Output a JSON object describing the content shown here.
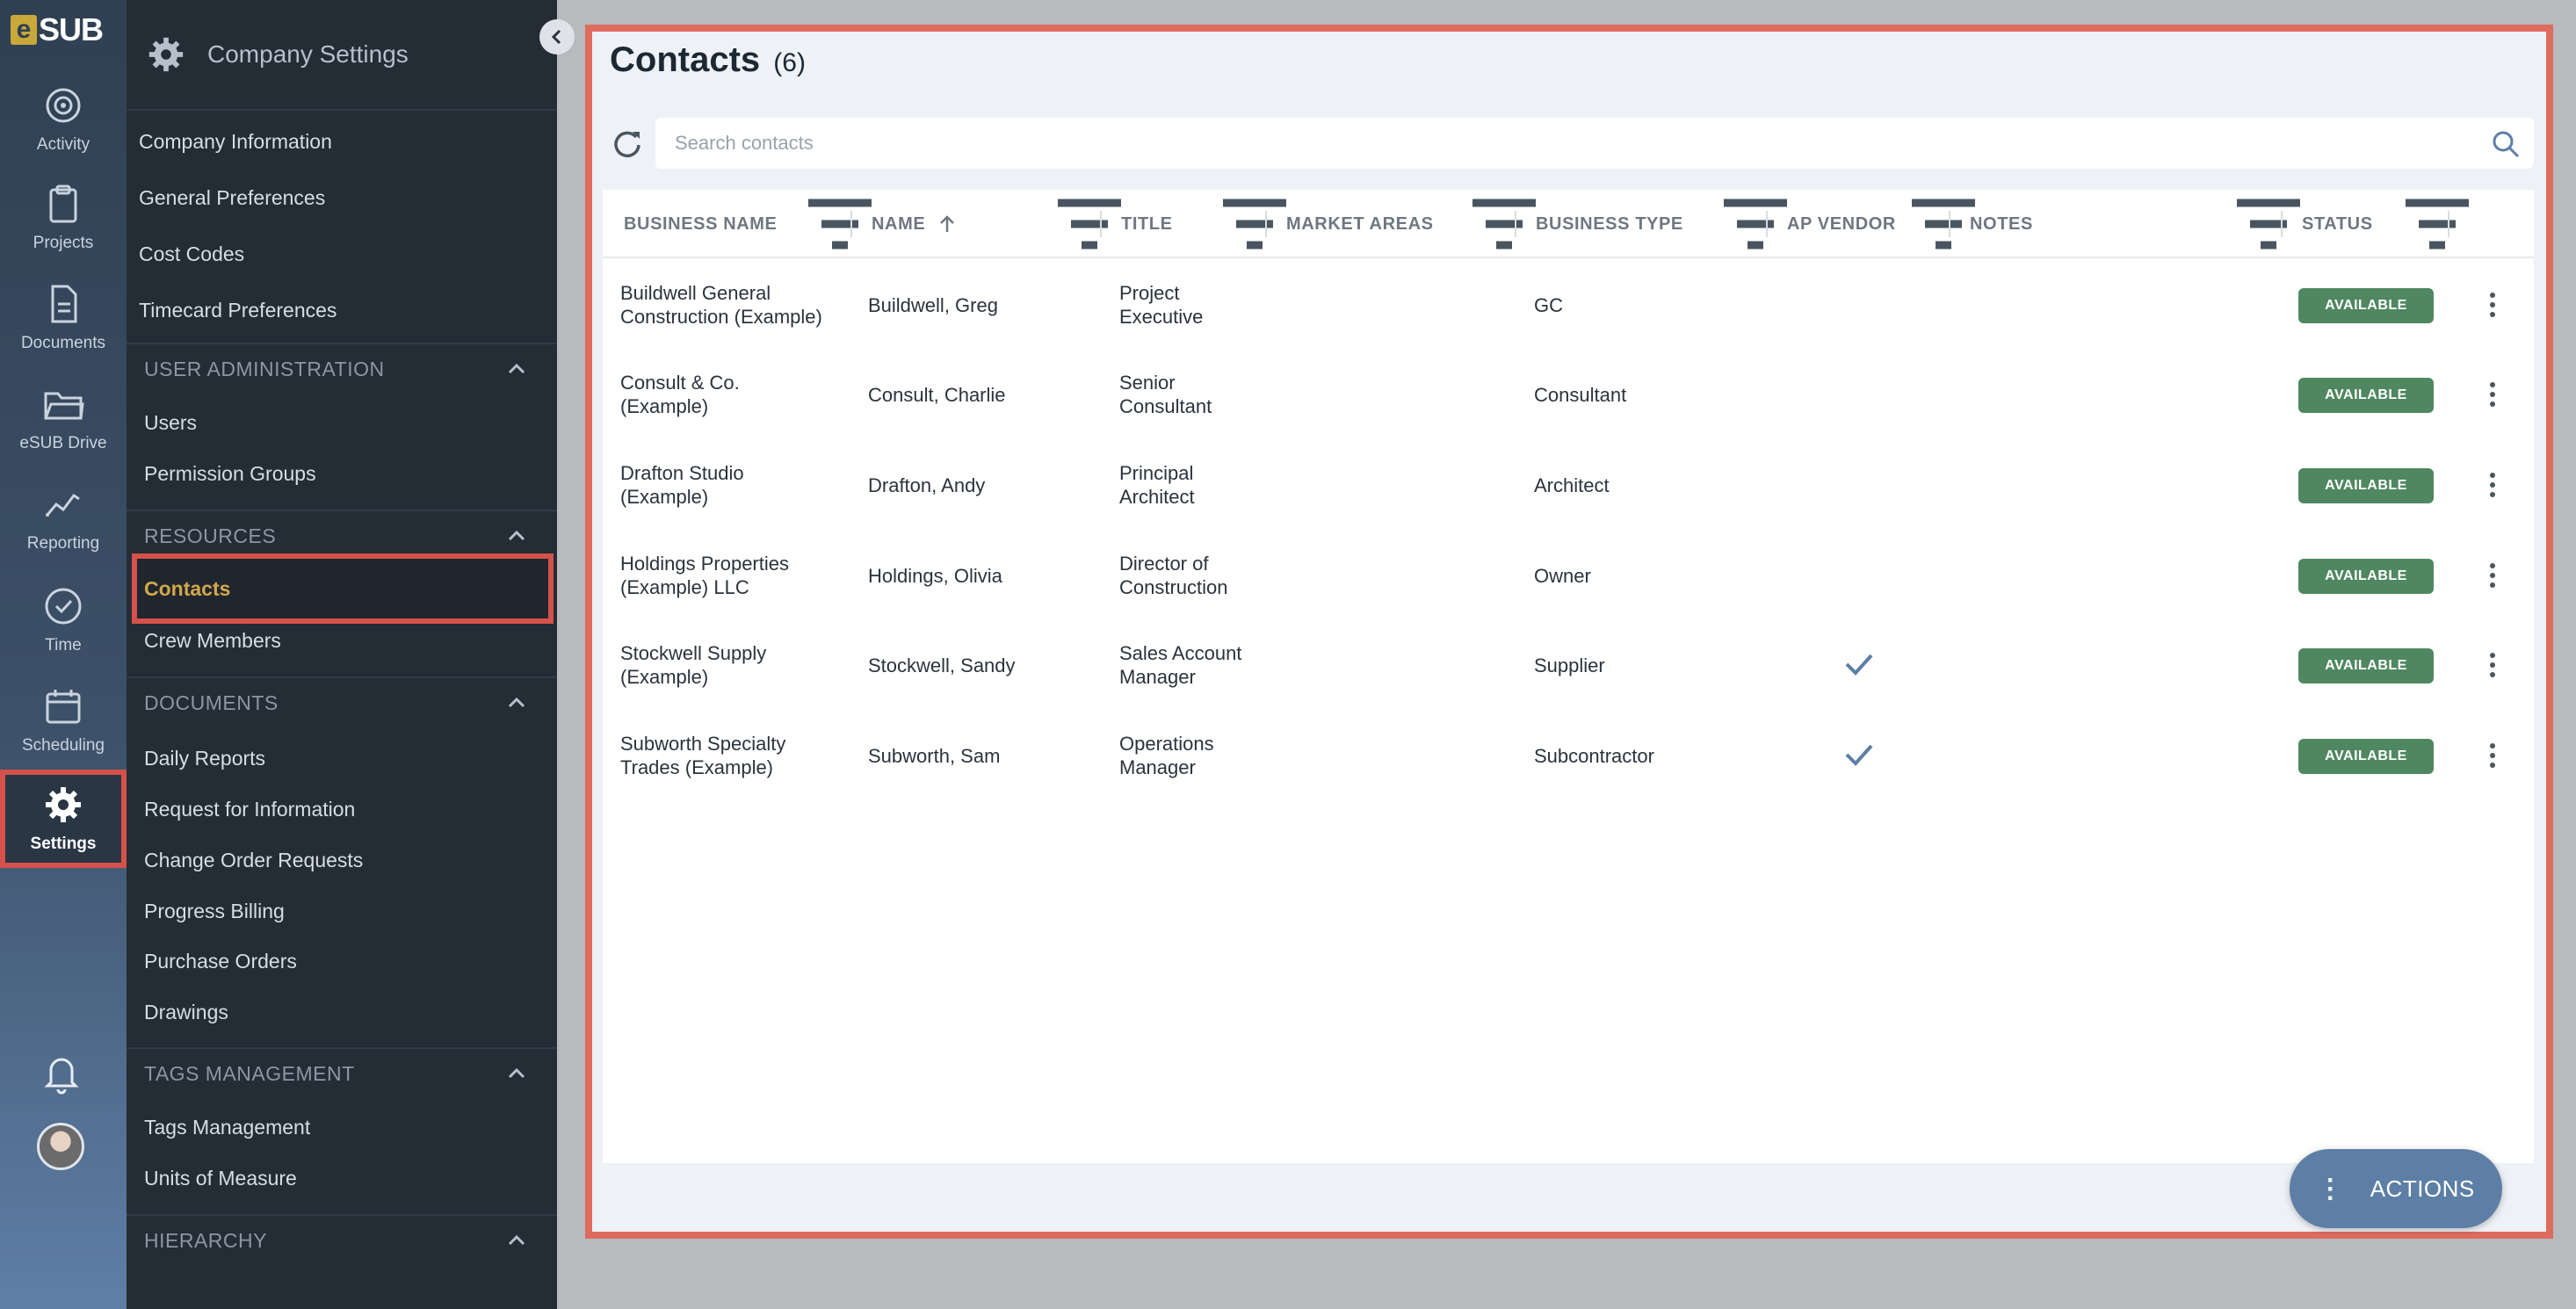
{
  "brand": {
    "logo_e": "e",
    "logo_rest": "SUB"
  },
  "rail": {
    "items": [
      {
        "label": "Activity",
        "icon": "activity-icon"
      },
      {
        "label": "Projects",
        "icon": "clipboard-icon"
      },
      {
        "label": "Documents",
        "icon": "document-icon"
      },
      {
        "label": "eSUB Drive",
        "icon": "folder-icon"
      },
      {
        "label": "Reporting",
        "icon": "chart-line-icon"
      },
      {
        "label": "Time",
        "icon": "clock-icon"
      },
      {
        "label": "Scheduling",
        "icon": "calendar-icon"
      },
      {
        "label": "Settings",
        "icon": "gear-icon"
      }
    ]
  },
  "panel": {
    "title": "Company Settings",
    "top_links": [
      "Company Information",
      "General Preferences",
      "Cost Codes",
      "Timecard Preferences"
    ],
    "sections": [
      {
        "title": "USER ADMINISTRATION",
        "links": [
          "Users",
          "Permission Groups"
        ]
      },
      {
        "title": "RESOURCES",
        "links": [
          "Contacts",
          "Crew Members"
        ]
      },
      {
        "title": "DOCUMENTS",
        "links": [
          "Daily Reports",
          "Request for Information",
          "Change Order Requests",
          "Progress Billing",
          "Purchase Orders",
          "Drawings"
        ]
      },
      {
        "title": "TAGS MANAGEMENT",
        "links": [
          "Tags Management",
          "Units of Measure"
        ]
      },
      {
        "title": "HIERARCHY",
        "links": []
      }
    ]
  },
  "main": {
    "title": "Contacts",
    "count": "(6)",
    "search_placeholder": "Search contacts",
    "columns": [
      "BUSINESS NAME",
      "NAME",
      "TITLE",
      "MARKET AREAS",
      "BUSINESS TYPE",
      "AP VENDOR",
      "NOTES",
      "STATUS"
    ],
    "rows": [
      {
        "business": [
          "Buildwell General",
          "Construction (Example)"
        ],
        "name": "Buildwell, Greg",
        "title": [
          "Project",
          "Executive"
        ],
        "type": "GC",
        "ap_vendor": false,
        "status": "AVAILABLE"
      },
      {
        "business": [
          "Consult & Co.",
          "(Example)"
        ],
        "name": "Consult, Charlie",
        "title": [
          "Senior",
          "Consultant"
        ],
        "type": "Consultant",
        "ap_vendor": false,
        "status": "AVAILABLE"
      },
      {
        "business": [
          "Drafton Studio",
          "(Example)"
        ],
        "name": "Drafton, Andy",
        "title": [
          "Principal",
          "Architect"
        ],
        "type": "Architect",
        "ap_vendor": false,
        "status": "AVAILABLE"
      },
      {
        "business": [
          "Holdings Properties",
          "(Example) LLC"
        ],
        "name": "Holdings, Olivia",
        "title": [
          "Director of",
          "Construction"
        ],
        "type": "Owner",
        "ap_vendor": false,
        "status": "AVAILABLE"
      },
      {
        "business": [
          "Stockwell Supply",
          "(Example)"
        ],
        "name": "Stockwell, Sandy",
        "title": [
          "Sales Account",
          "Manager"
        ],
        "type": "Supplier",
        "ap_vendor": true,
        "status": "AVAILABLE"
      },
      {
        "business": [
          "Subworth Specialty",
          "Trades (Example)"
        ],
        "name": "Subworth, Sam",
        "title": [
          "Operations",
          "Manager"
        ],
        "type": "Subcontractor",
        "ap_vendor": true,
        "status": "AVAILABLE"
      }
    ],
    "actions_label": "ACTIONS"
  },
  "colors": {
    "accent_red": "#dd6b5e",
    "available_green": "#4f8760",
    "active_link_gold": "#d4a74a",
    "actions_blue": "#5d7fa6"
  }
}
